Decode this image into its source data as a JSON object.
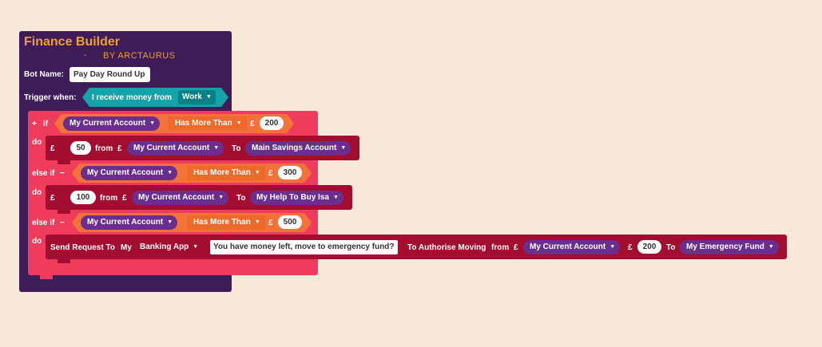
{
  "app": {
    "title": "Finance Builder",
    "dash": "-",
    "byline": "BY ARCTAURUS"
  },
  "bot": {
    "label": "Bot Name:",
    "value": "Pay Day Round Up"
  },
  "trigger": {
    "label": "Trigger when:",
    "text": "I receive money from",
    "source": "Work"
  },
  "if_block": {
    "plus": "+",
    "if_label": "if",
    "do_label": "do",
    "elseif_label": "else if",
    "minus": "−",
    "pound": "£",
    "from_label": "from",
    "to_label": "To",
    "branches": [
      {
        "account": "My Current Account",
        "condition": "Has More Than",
        "amount": "200"
      },
      {
        "account": "My Current Account",
        "condition": "Has More Than",
        "amount": "300"
      },
      {
        "account": "My Current Account",
        "condition": "Has More Than",
        "amount": "500"
      }
    ],
    "actions": [
      {
        "amount": "50",
        "from": "My Current Account",
        "to": "Main Savings Account"
      },
      {
        "amount": "100",
        "from": "My Current Account",
        "to": "My Help To Buy Isa"
      }
    ],
    "request": {
      "send_label": "Send Request To",
      "my_label": "My",
      "app": "Banking App",
      "message": "You have money left, move to emergency fund?",
      "authorise_label": "To Authorise Moving",
      "from_label": "from",
      "from_account": "My Current Account",
      "amount": "200",
      "to_label": "To",
      "to_account": "My Emergency Fund"
    }
  }
}
